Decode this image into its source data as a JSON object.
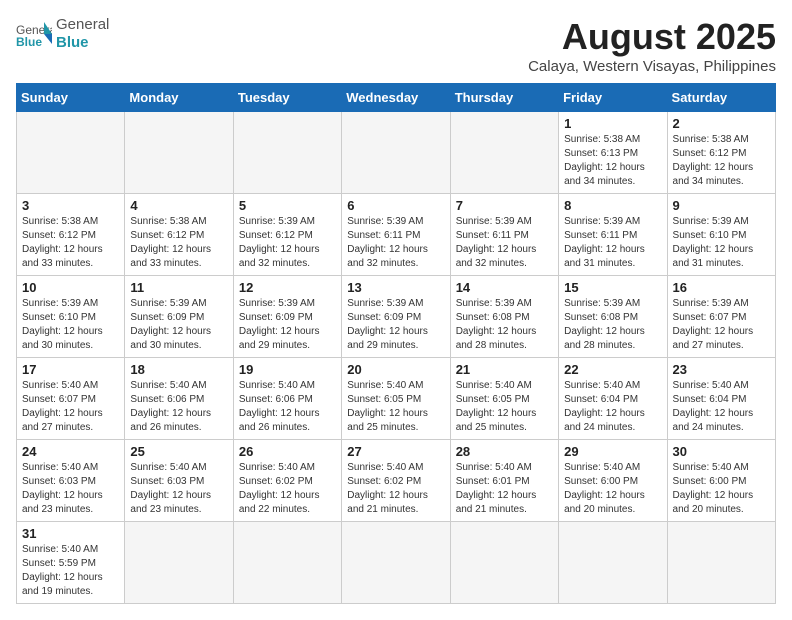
{
  "header": {
    "logo_text_general": "General",
    "logo_text_blue": "Blue",
    "month_title": "August 2025",
    "subtitle": "Calaya, Western Visayas, Philippines"
  },
  "weekdays": [
    "Sunday",
    "Monday",
    "Tuesday",
    "Wednesday",
    "Thursday",
    "Friday",
    "Saturday"
  ],
  "weeks": [
    [
      {
        "day": null,
        "info": null
      },
      {
        "day": null,
        "info": null
      },
      {
        "day": null,
        "info": null
      },
      {
        "day": null,
        "info": null
      },
      {
        "day": null,
        "info": null
      },
      {
        "day": "1",
        "info": "Sunrise: 5:38 AM\nSunset: 6:13 PM\nDaylight: 12 hours\nand 34 minutes."
      },
      {
        "day": "2",
        "info": "Sunrise: 5:38 AM\nSunset: 6:12 PM\nDaylight: 12 hours\nand 34 minutes."
      }
    ],
    [
      {
        "day": "3",
        "info": "Sunrise: 5:38 AM\nSunset: 6:12 PM\nDaylight: 12 hours\nand 33 minutes."
      },
      {
        "day": "4",
        "info": "Sunrise: 5:38 AM\nSunset: 6:12 PM\nDaylight: 12 hours\nand 33 minutes."
      },
      {
        "day": "5",
        "info": "Sunrise: 5:39 AM\nSunset: 6:12 PM\nDaylight: 12 hours\nand 32 minutes."
      },
      {
        "day": "6",
        "info": "Sunrise: 5:39 AM\nSunset: 6:11 PM\nDaylight: 12 hours\nand 32 minutes."
      },
      {
        "day": "7",
        "info": "Sunrise: 5:39 AM\nSunset: 6:11 PM\nDaylight: 12 hours\nand 32 minutes."
      },
      {
        "day": "8",
        "info": "Sunrise: 5:39 AM\nSunset: 6:11 PM\nDaylight: 12 hours\nand 31 minutes."
      },
      {
        "day": "9",
        "info": "Sunrise: 5:39 AM\nSunset: 6:10 PM\nDaylight: 12 hours\nand 31 minutes."
      }
    ],
    [
      {
        "day": "10",
        "info": "Sunrise: 5:39 AM\nSunset: 6:10 PM\nDaylight: 12 hours\nand 30 minutes."
      },
      {
        "day": "11",
        "info": "Sunrise: 5:39 AM\nSunset: 6:09 PM\nDaylight: 12 hours\nand 30 minutes."
      },
      {
        "day": "12",
        "info": "Sunrise: 5:39 AM\nSunset: 6:09 PM\nDaylight: 12 hours\nand 29 minutes."
      },
      {
        "day": "13",
        "info": "Sunrise: 5:39 AM\nSunset: 6:09 PM\nDaylight: 12 hours\nand 29 minutes."
      },
      {
        "day": "14",
        "info": "Sunrise: 5:39 AM\nSunset: 6:08 PM\nDaylight: 12 hours\nand 28 minutes."
      },
      {
        "day": "15",
        "info": "Sunrise: 5:39 AM\nSunset: 6:08 PM\nDaylight: 12 hours\nand 28 minutes."
      },
      {
        "day": "16",
        "info": "Sunrise: 5:39 AM\nSunset: 6:07 PM\nDaylight: 12 hours\nand 27 minutes."
      }
    ],
    [
      {
        "day": "17",
        "info": "Sunrise: 5:40 AM\nSunset: 6:07 PM\nDaylight: 12 hours\nand 27 minutes."
      },
      {
        "day": "18",
        "info": "Sunrise: 5:40 AM\nSunset: 6:06 PM\nDaylight: 12 hours\nand 26 minutes."
      },
      {
        "day": "19",
        "info": "Sunrise: 5:40 AM\nSunset: 6:06 PM\nDaylight: 12 hours\nand 26 minutes."
      },
      {
        "day": "20",
        "info": "Sunrise: 5:40 AM\nSunset: 6:05 PM\nDaylight: 12 hours\nand 25 minutes."
      },
      {
        "day": "21",
        "info": "Sunrise: 5:40 AM\nSunset: 6:05 PM\nDaylight: 12 hours\nand 25 minutes."
      },
      {
        "day": "22",
        "info": "Sunrise: 5:40 AM\nSunset: 6:04 PM\nDaylight: 12 hours\nand 24 minutes."
      },
      {
        "day": "23",
        "info": "Sunrise: 5:40 AM\nSunset: 6:04 PM\nDaylight: 12 hours\nand 24 minutes."
      }
    ],
    [
      {
        "day": "24",
        "info": "Sunrise: 5:40 AM\nSunset: 6:03 PM\nDaylight: 12 hours\nand 23 minutes."
      },
      {
        "day": "25",
        "info": "Sunrise: 5:40 AM\nSunset: 6:03 PM\nDaylight: 12 hours\nand 23 minutes."
      },
      {
        "day": "26",
        "info": "Sunrise: 5:40 AM\nSunset: 6:02 PM\nDaylight: 12 hours\nand 22 minutes."
      },
      {
        "day": "27",
        "info": "Sunrise: 5:40 AM\nSunset: 6:02 PM\nDaylight: 12 hours\nand 21 minutes."
      },
      {
        "day": "28",
        "info": "Sunrise: 5:40 AM\nSunset: 6:01 PM\nDaylight: 12 hours\nand 21 minutes."
      },
      {
        "day": "29",
        "info": "Sunrise: 5:40 AM\nSunset: 6:00 PM\nDaylight: 12 hours\nand 20 minutes."
      },
      {
        "day": "30",
        "info": "Sunrise: 5:40 AM\nSunset: 6:00 PM\nDaylight: 12 hours\nand 20 minutes."
      }
    ],
    [
      {
        "day": "31",
        "info": "Sunrise: 5:40 AM\nSunset: 5:59 PM\nDaylight: 12 hours\nand 19 minutes."
      },
      {
        "day": null,
        "info": null
      },
      {
        "day": null,
        "info": null
      },
      {
        "day": null,
        "info": null
      },
      {
        "day": null,
        "info": null
      },
      {
        "day": null,
        "info": null
      },
      {
        "day": null,
        "info": null
      }
    ]
  ]
}
